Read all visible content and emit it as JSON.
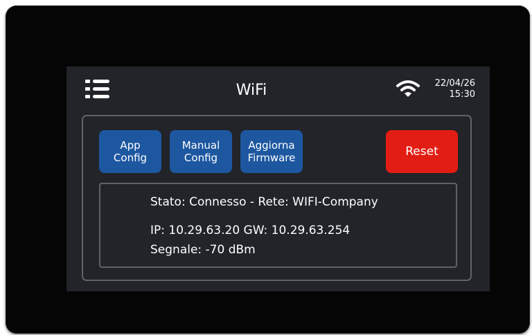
{
  "header": {
    "title": "WiFi",
    "date": "22/04/26",
    "time": "15:30"
  },
  "icons": {
    "menu": "menu-list-icon",
    "wifi": "wifi-icon"
  },
  "buttons": {
    "app_config": [
      "App",
      "Config"
    ],
    "manual_config": [
      "Manual",
      "Config"
    ],
    "update_firmware": [
      "Aggiorna",
      "Firmware"
    ],
    "reset": "Reset"
  },
  "status": {
    "line1": "Stato: Connesso - Rete: WIFI-Company",
    "line2": "IP: 10.29.63.20 GW: 10.29.63.254",
    "line3": "Segnale: -70 dBm"
  },
  "colors": {
    "screen_background": "#222429",
    "button_blue": "#1d57a0",
    "button_red": "#e21d13",
    "border_gray": "#5f6369"
  }
}
